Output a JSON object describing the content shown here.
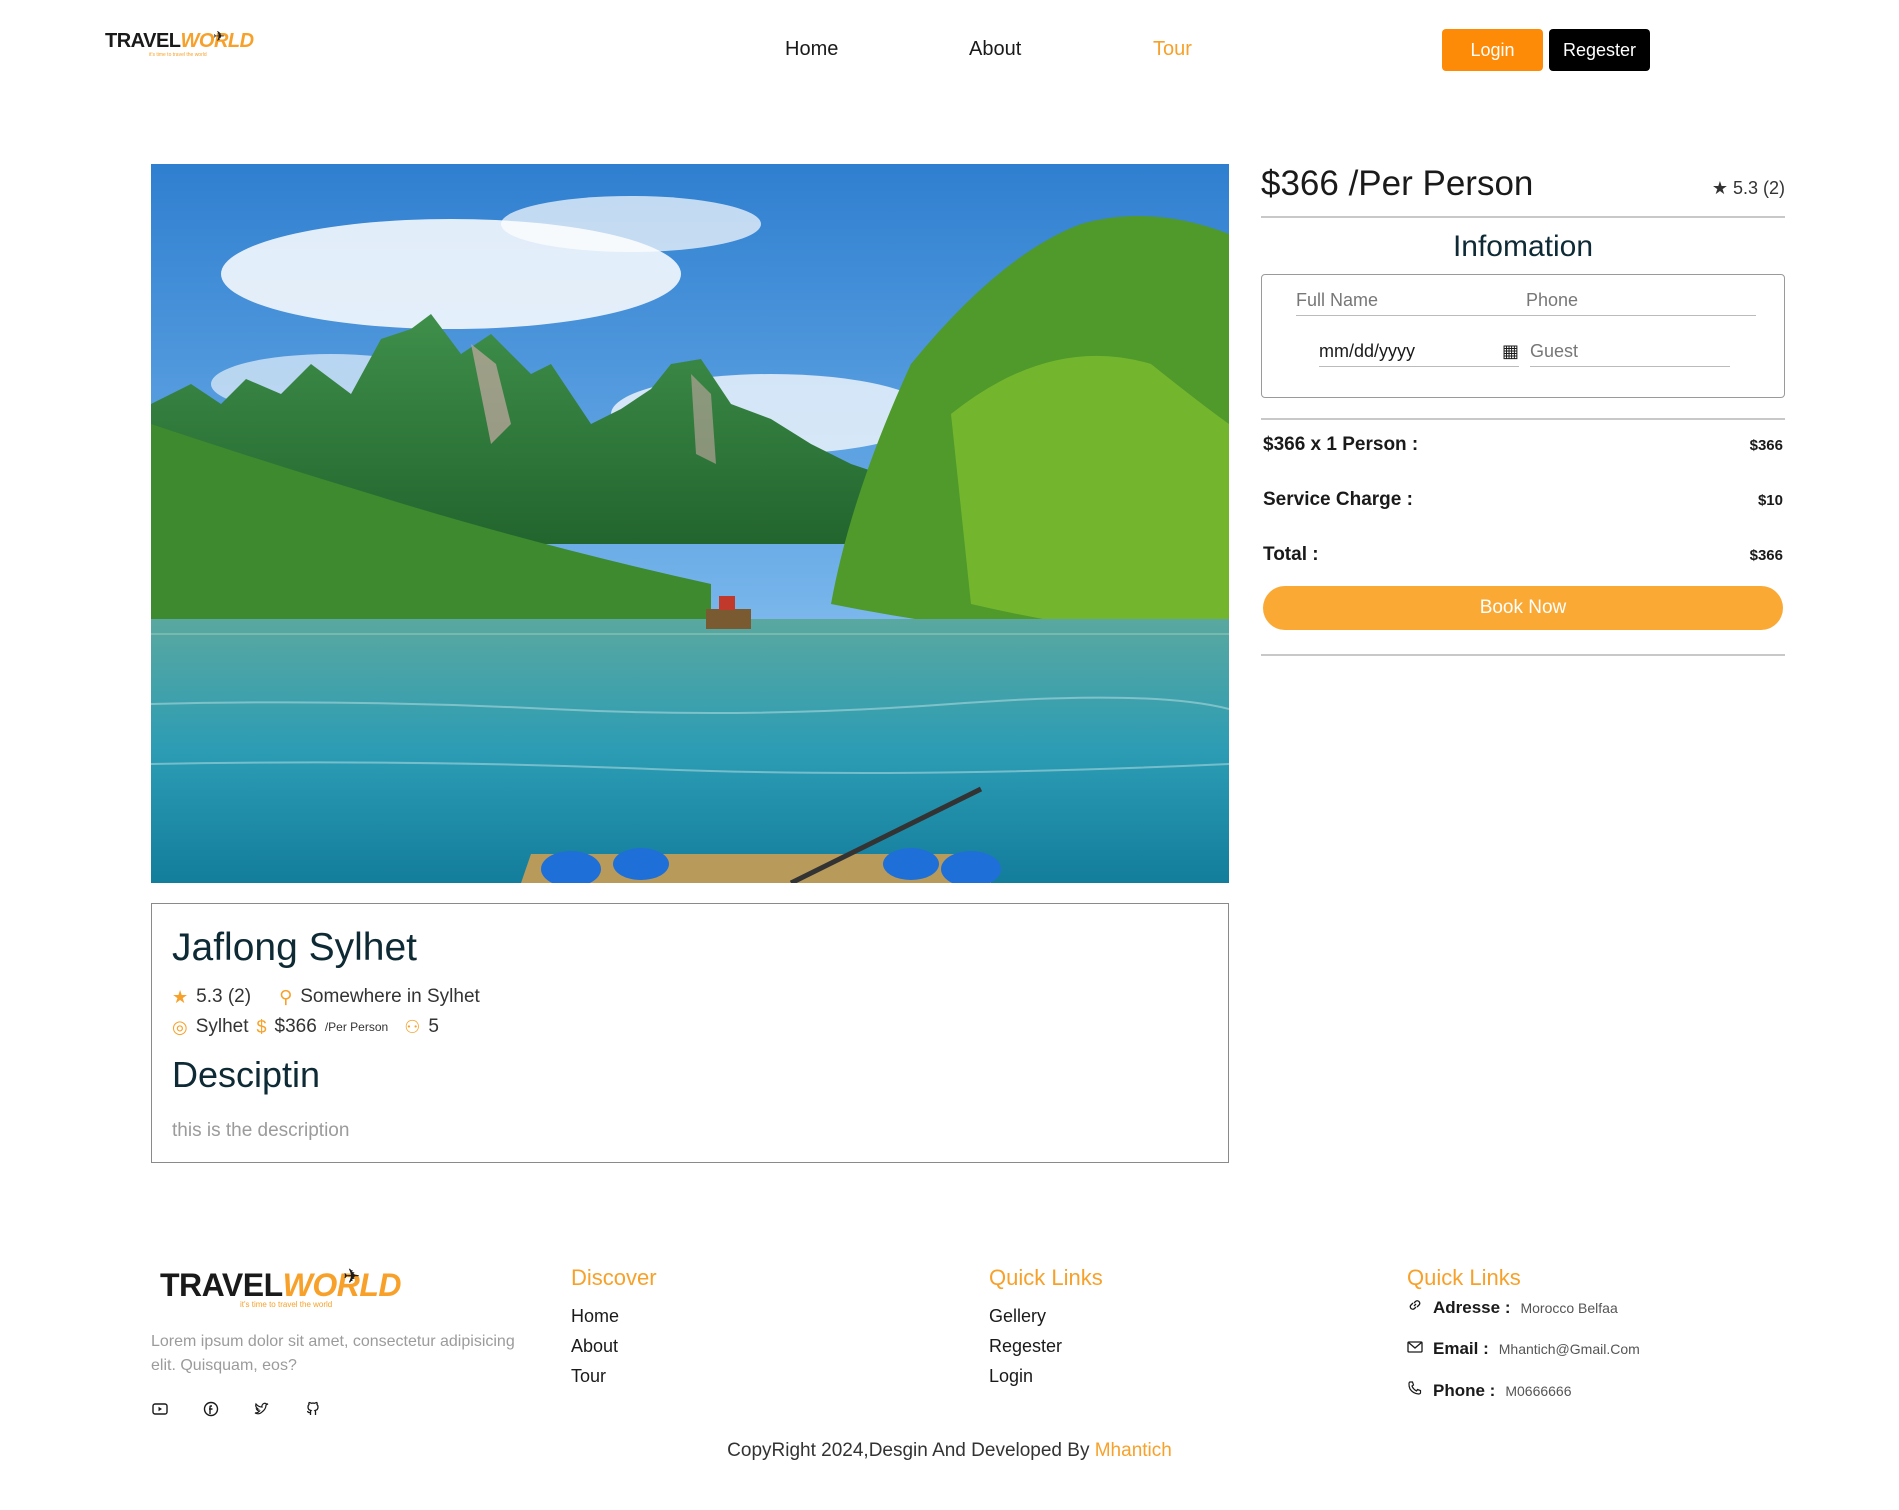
{
  "brand": {
    "logo_primary": "TRAVEL",
    "logo_secondary": "WORLD",
    "logo_tagline": "it's time to travel the world"
  },
  "nav": {
    "items": [
      "Home",
      "About",
      "Tour"
    ],
    "active": "Tour",
    "login_label": "Login",
    "register_label": "Regester"
  },
  "colors": {
    "accent": "#f7a12a",
    "login_button": "#fd8b07",
    "register_button": "#000000",
    "book_button": "#faa935"
  },
  "tour": {
    "title": "Jaflong Sylhet",
    "rating": "5.3 (2)",
    "address": "Somewhere in Sylhet",
    "city": "Sylhet",
    "price": "$366",
    "price_unit": "/Per Person",
    "max_group": "5",
    "description_heading": "Desciptin",
    "description": "this is the description",
    "image_alt": "river with mountains and boat"
  },
  "booking": {
    "price_heading": "$366 /Per Person",
    "rating": "5.3 (2)",
    "info_title": "Infomation",
    "full_name_placeholder": "Full Name",
    "phone_placeholder": "Phone",
    "date_placeholder": "mm/dd/yyyy",
    "guest_placeholder": "Guest",
    "line_price_label": "$366 x 1 Person :",
    "line_price_value": "$366",
    "service_label": "Service Charge :",
    "service_value": "$10",
    "total_label": "Total :",
    "total_value": "$366",
    "book_label": "Book Now"
  },
  "footer": {
    "about": "Lorem ipsum dolor sit amet, consectetur adipisicing elit. Quisquam, eos?",
    "socials": [
      "youtube-icon",
      "facebook-icon",
      "twitter-icon",
      "github-icon"
    ],
    "discover_title": "Discover",
    "discover_links": [
      "Home",
      "About",
      "Tour"
    ],
    "quick_title": "Quick Links",
    "quick_links": [
      "Gellery",
      "Regester",
      "Login"
    ],
    "contact_title": "Quick Links",
    "address_label": "Adresse :",
    "address_value": "Morocco Belfaa",
    "email_label": "Email :",
    "email_value": "Mhantich@Gmail.Com",
    "phone_label": "Phone :",
    "phone_value": "M0666666",
    "copyright": "CopyRight 2024,Desgin And Developed By",
    "author": "Mhantich"
  }
}
